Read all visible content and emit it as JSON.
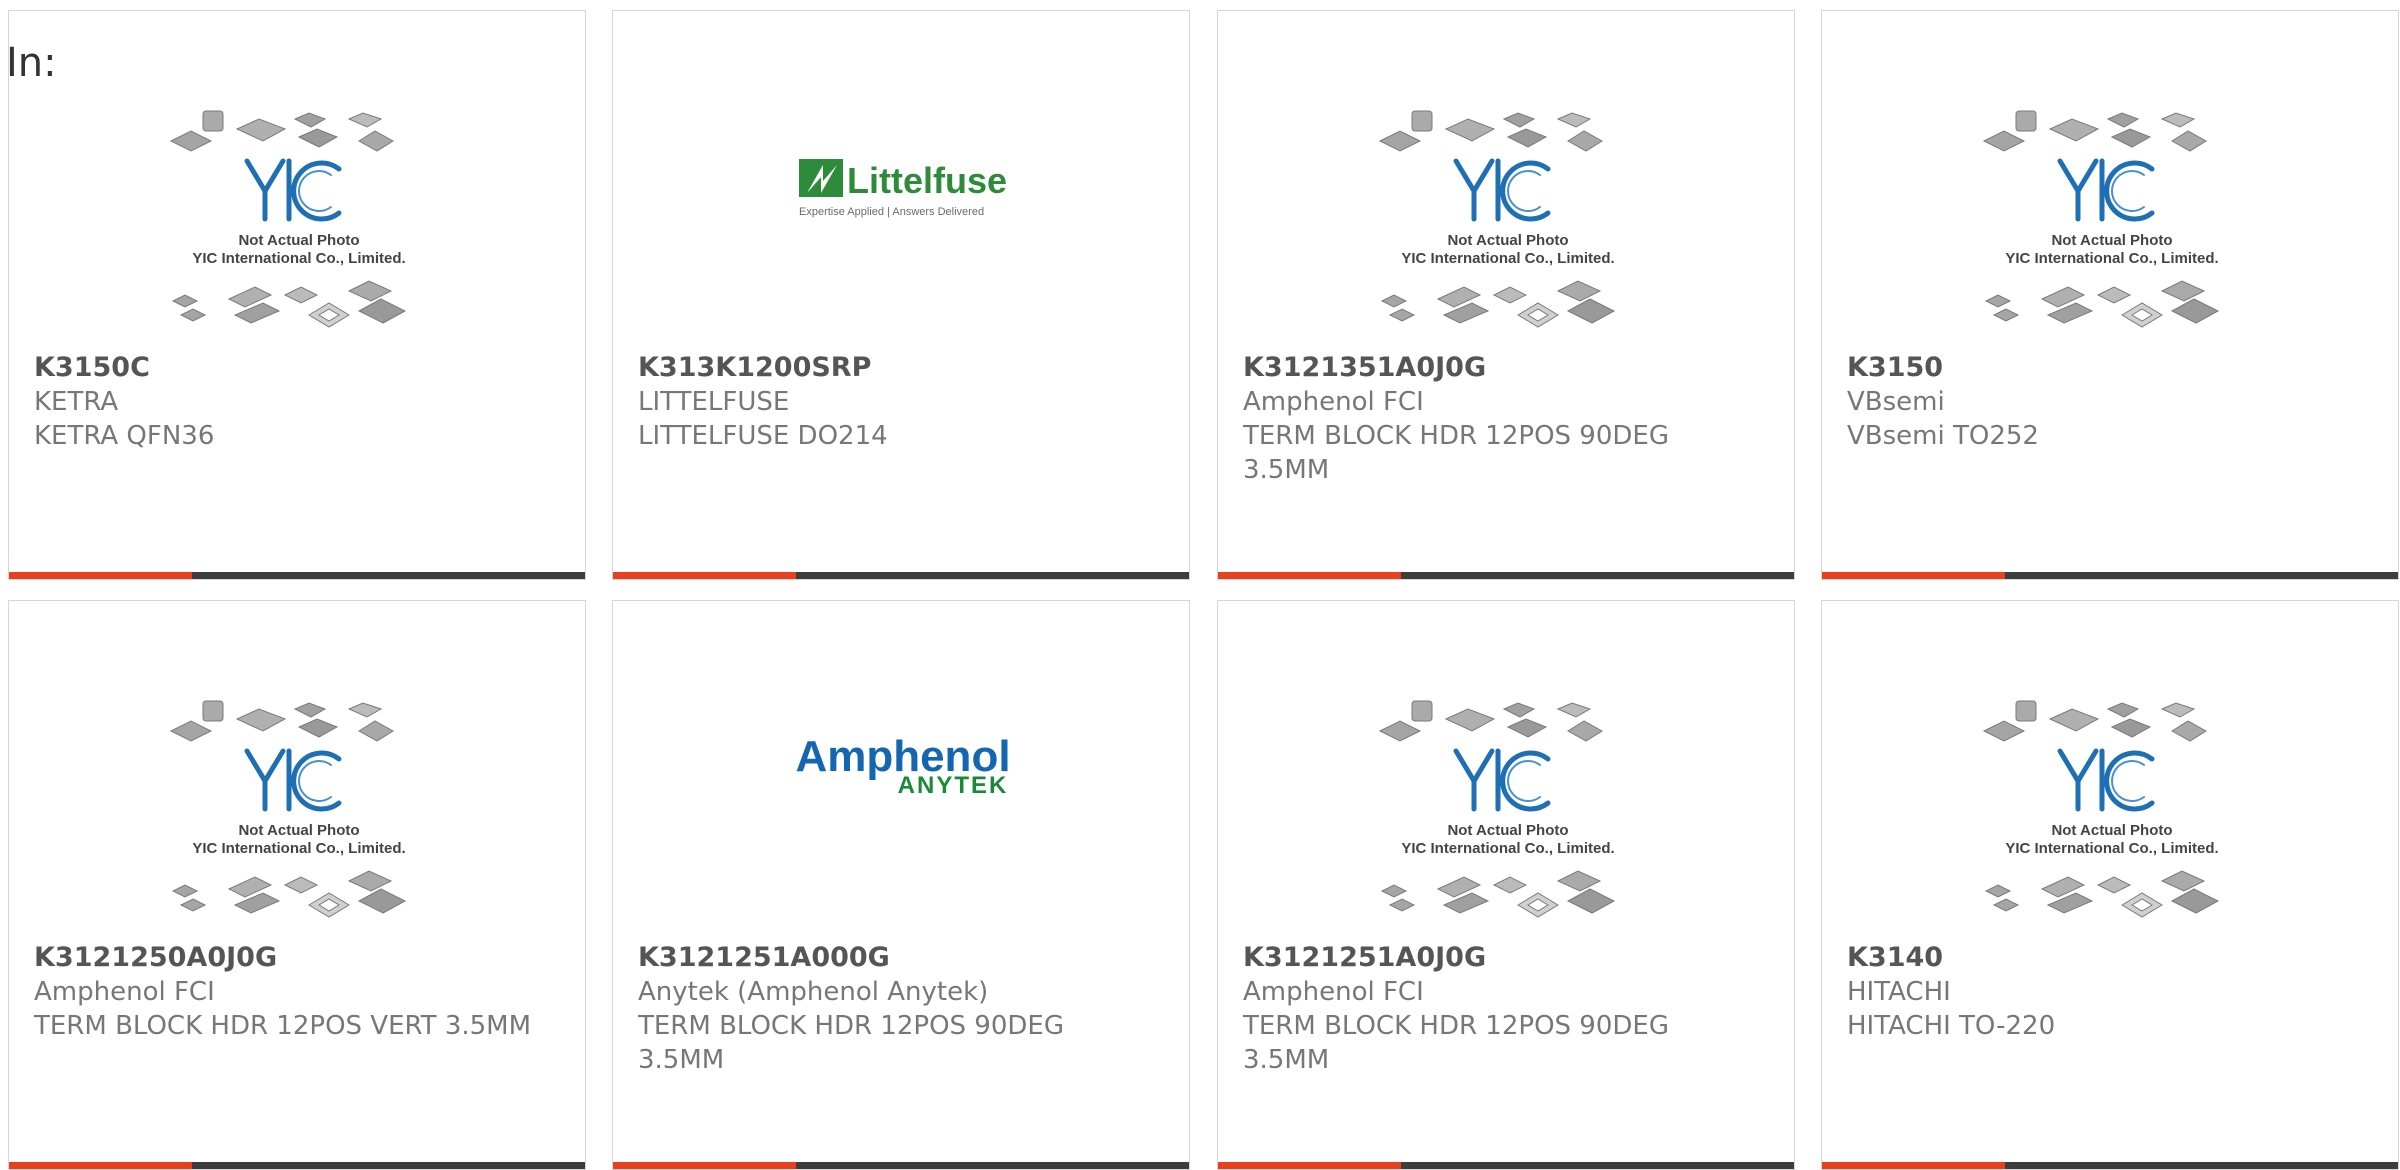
{
  "page": {
    "in_label": "In:"
  },
  "placeholder": {
    "line1": "Not Actual Photo",
    "line2": "YIC International Co., Limited.",
    "brand": "YIC"
  },
  "logos": {
    "littelfuse": {
      "name": "Littelfuse",
      "tagline": "Expertise Applied | Answers Delivered"
    },
    "amphenol": {
      "name": "Amphenol",
      "sub": "ANYTEK"
    }
  },
  "colors": {
    "accent": "#e8401c",
    "bar": "#3d3d3d",
    "yic_blue": "#1f6fb5",
    "littelfuse_green": "#2e8b3a",
    "amphenol_blue": "#1466b0",
    "anytek_green": "#1a8a3a"
  },
  "products": [
    {
      "pn": "K3150C",
      "mfr": "KETRA",
      "desc": "KETRA QFN36",
      "image": "yic-placeholder"
    },
    {
      "pn": "K313K1200SRP",
      "mfr": "LITTELFUSE",
      "desc": "LITTELFUSE DO214",
      "image": "littelfuse-logo"
    },
    {
      "pn": "K3121351A0J0G",
      "mfr": "Amphenol FCI",
      "desc": "TERM BLOCK HDR 12POS 90DEG 3.5MM",
      "image": "yic-placeholder"
    },
    {
      "pn": "K3150",
      "mfr": "VBsemi",
      "desc": "VBsemi TO252",
      "image": "yic-placeholder"
    },
    {
      "pn": "K3121250A0J0G",
      "mfr": "Amphenol FCI",
      "desc": "TERM BLOCK HDR 12POS VERT 3.5MM",
      "image": "yic-placeholder"
    },
    {
      "pn": "K3121251A000G",
      "mfr": "Anytek (Amphenol Anytek)",
      "desc": "TERM BLOCK HDR 12POS 90DEG 3.5MM",
      "image": "amphenol-logo"
    },
    {
      "pn": "K3121251A0J0G",
      "mfr": "Amphenol FCI",
      "desc": "TERM BLOCK HDR 12POS 90DEG 3.5MM",
      "image": "yic-placeholder"
    },
    {
      "pn": "K3140",
      "mfr": "HITACHI",
      "desc": "HITACHI TO-220",
      "image": "yic-placeholder"
    }
  ]
}
